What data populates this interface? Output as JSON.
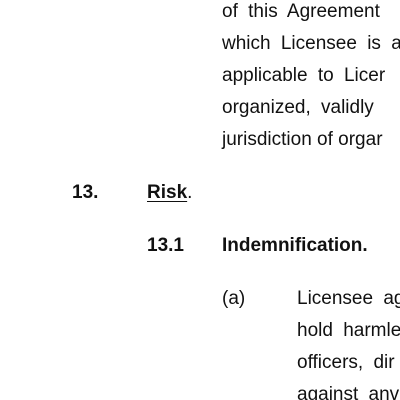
{
  "document": {
    "top_paragraph_lines": [
      "of this Agreement",
      "which Licensee is a",
      "applicable to Licer",
      "organized, validly",
      "jurisdiction of orgar"
    ],
    "section": {
      "number": "13.",
      "title": "Risk",
      "title_suffix": "."
    },
    "subsection": {
      "number": "13.1",
      "title": "Indemnification."
    },
    "clause": {
      "label": "(a)",
      "lines": [
        "Licensee ag",
        "hold harmle",
        "officers, dir",
        "against anv"
      ]
    }
  }
}
